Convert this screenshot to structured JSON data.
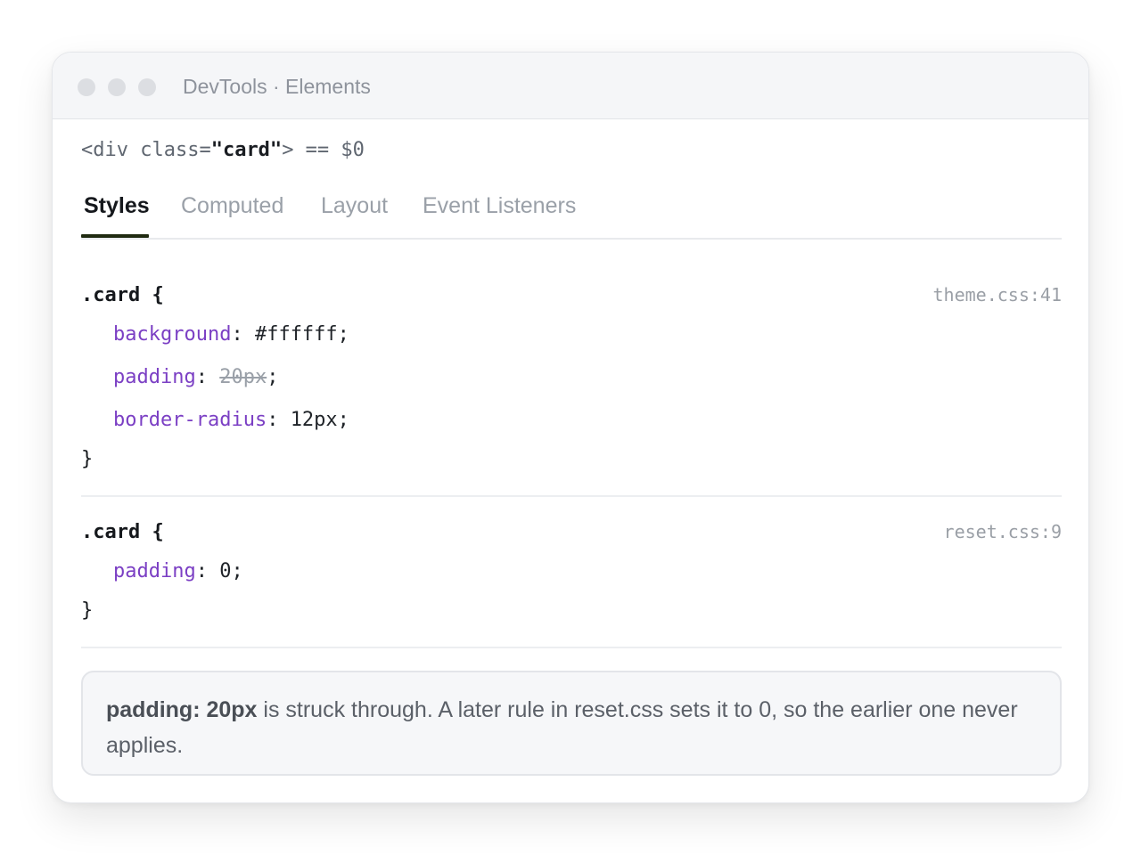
{
  "window": {
    "title": "DevTools · Elements"
  },
  "breadcrumb": {
    "open": "<div class=",
    "value": "\"card\"",
    "close": "> == $0"
  },
  "tabs": [
    {
      "label": "Styles",
      "active": true
    },
    {
      "label": "Computed",
      "active": false
    },
    {
      "label": "Layout",
      "active": false
    },
    {
      "label": "Event Listeners",
      "active": false
    }
  ],
  "rules": [
    {
      "selector": ".card {",
      "source": "theme.css:41",
      "declarations": [
        {
          "property": "background",
          "value": "#ffffff",
          "overridden": false
        },
        {
          "property": "padding",
          "value": "20px",
          "overridden": true
        },
        {
          "property": "border-radius",
          "value": "12px",
          "overridden": false
        }
      ],
      "close": "}"
    },
    {
      "selector": ".card {",
      "source": "reset.css:9",
      "declarations": [
        {
          "property": "padding",
          "value": "0",
          "overridden": false
        }
      ],
      "close": "}"
    }
  ],
  "note": {
    "bold": "padding: 20px",
    "text": " is struck through. A later rule in reset.css sets it to 0, so the earlier one never applies."
  },
  "colors": {
    "property": "#7b3fc4",
    "struck": "#9aa0a8",
    "tab_underline": "#1f2a10"
  }
}
